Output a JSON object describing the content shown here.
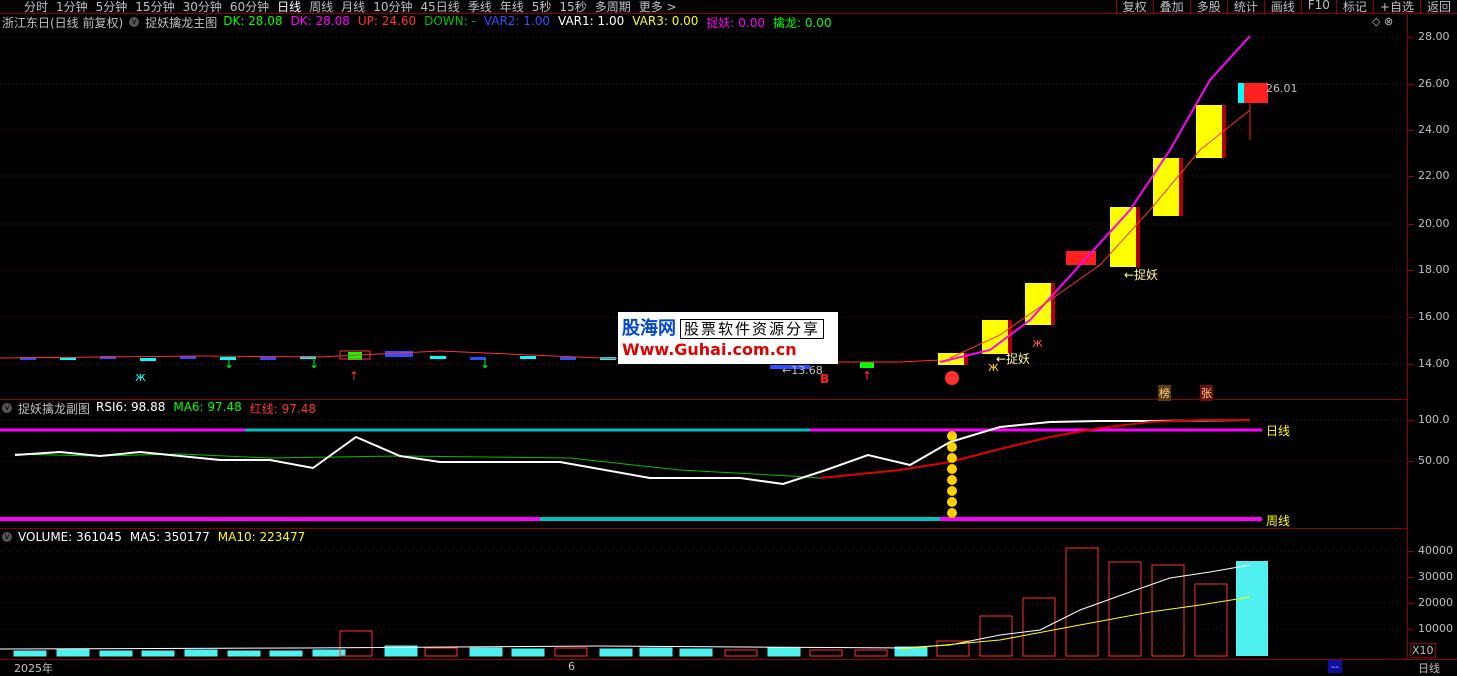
{
  "toolbar": {
    "periods": [
      "分时",
      "1分钟",
      "5分钟",
      "15分钟",
      "30分钟",
      "60分钟",
      "日线",
      "周线",
      "月线",
      "10分钟",
      "45日线",
      "季线",
      "年线",
      "5秒",
      "15秒",
      "多周期",
      "更多 >"
    ],
    "active_period": "日线",
    "right_buttons": [
      "复权",
      "叠加",
      "多股",
      "统计",
      "画线",
      "F10",
      "标记",
      "+自选",
      "返回"
    ]
  },
  "main_panel": {
    "title": "浙江东日(日线 前复权)",
    "indicator_name": "捉妖擒龙主图",
    "values": [
      {
        "label": "DK: 28.08",
        "color": "#00ff00"
      },
      {
        "label": "DK: 28.08",
        "color": "#ff00ff"
      },
      {
        "label": "UP: 24.60",
        "color": "#ff3030"
      },
      {
        "label": "DOWN: -",
        "color": "#00c000"
      },
      {
        "label": "VAR2: 1.00",
        "color": "#3050ff"
      },
      {
        "label": "VAR1: 1.00",
        "color": "#ffffff"
      },
      {
        "label": "VAR3: 0.00",
        "color": "#ffff00"
      },
      {
        "label": "捉妖: 0.00",
        "color": "#ff00ff"
      },
      {
        "label": "擒龙: 0.00",
        "color": "#00ff00"
      }
    ],
    "y_labels": [
      "28.00",
      "26.00",
      "24.00",
      "22.00",
      "20.00",
      "18.00",
      "16.00",
      "14.00"
    ],
    "annotations": {
      "low_price": "←13.68",
      "high_price": "26.01",
      "catch1": "←捉妖",
      "catch2": "←捉妖",
      "buy": "B",
      "tag1": "榜",
      "tag2": "张"
    }
  },
  "sub_panel": {
    "indicator_name": "捉妖擒龙副图",
    "values": [
      {
        "label": "RSI6: 98.88",
        "color": "#ffffff"
      },
      {
        "label": "MA6: 97.48",
        "color": "#00ff00"
      },
      {
        "label": "红线: 97.48",
        "color": "#ff3030"
      }
    ],
    "y_labels": [
      "100.0",
      "50.00"
    ],
    "line_labels": {
      "daily": "日线",
      "weekly": "周线"
    }
  },
  "volume_panel": {
    "values": [
      {
        "label": "VOLUME: 361045",
        "color": "#ffffff"
      },
      {
        "label": "MA5: 350177",
        "color": "#ffffff"
      },
      {
        "label": "MA10: 223477",
        "color": "#ffff00"
      }
    ],
    "y_labels": [
      "40000",
      "30000",
      "20000",
      "10000"
    ],
    "unit": "X10"
  },
  "bottom": {
    "year_label": "2025年",
    "month_label": "6",
    "right_label": "日线",
    "scroll": "--"
  },
  "watermark": {
    "line1": "股海网",
    "line1b": "股票软件资源分享",
    "line2": "Www.Guhai.com.cn"
  },
  "colors": {
    "up": "#ff3030",
    "down": "#00ffff",
    "border": "#8b0000",
    "accent_yellow": "#ffff00",
    "magenta": "#ff00ff"
  }
}
